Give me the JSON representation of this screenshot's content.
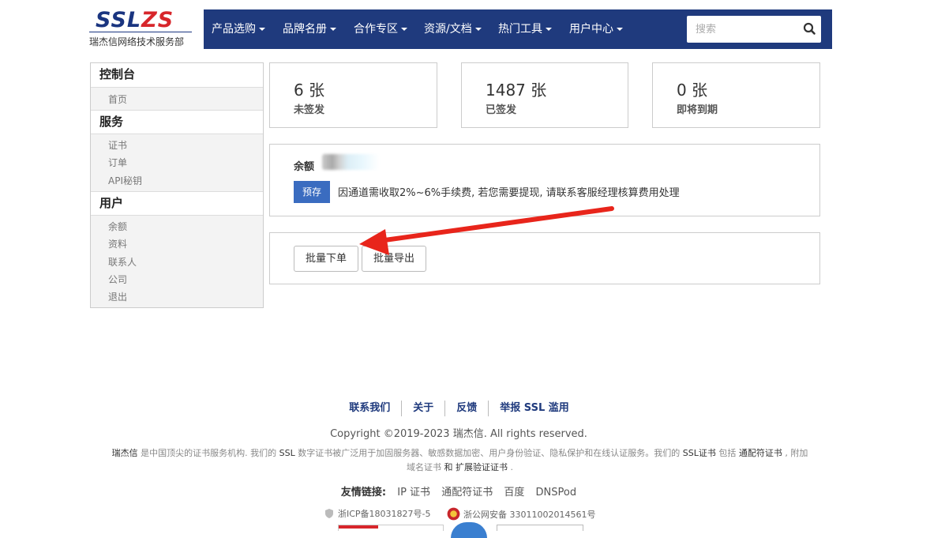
{
  "brand": {
    "logo_a": "SSL",
    "logo_b": "ZS",
    "subtitle": "瑞杰信网络技术服务部"
  },
  "nav": {
    "items": [
      "产品选购",
      "品牌名册",
      "合作专区",
      "资源/文档",
      "热门工具",
      "用户中心"
    ],
    "search_placeholder": "搜索"
  },
  "sidebar": {
    "sections": [
      {
        "title": "控制台",
        "links": [
          "首页"
        ]
      },
      {
        "title": "服务",
        "links": [
          "证书",
          "订单",
          "API秘钥"
        ]
      },
      {
        "title": "用户",
        "links": [
          "余额",
          "资料",
          "联系人",
          "公司",
          "退出"
        ]
      }
    ]
  },
  "stats": [
    {
      "value": "6 张",
      "label": "未签发"
    },
    {
      "value": "1487 张",
      "label": "已签发"
    },
    {
      "value": "0 张",
      "label": "即将到期"
    }
  ],
  "balance": {
    "label": "余额",
    "badge": "预存",
    "notice": "因通道需收取2%~6%手续费, 若您需要提现, 请联系客服经理核算费用处理"
  },
  "actions": {
    "bulk_order": "批量下单",
    "bulk_export": "批量导出"
  },
  "footer": {
    "links": [
      "联系我们",
      "关于",
      "反馈",
      "举报 SSL 滥用"
    ],
    "copyright": "Copyright ©2019-2023 瑞杰信. All rights reserved.",
    "desc": {
      "p1": "瑞杰信",
      "p2": " 是中国顶尖的证书服务机构. 我们的 ",
      "p3": "SSL",
      "p4": " 数字证书被广泛用于加固服务器、敏感数据加密、用户身份验证、隐私保护和在线认证服务。我们的 ",
      "p5": "SSL证书",
      "p6": " 包括 ",
      "p7": "通配符证书",
      "p8": " , 附加域名证书 ",
      "p9": "和",
      "p10": " 扩展验证证书",
      "p11": " ."
    },
    "friends_title": "友情链接:",
    "friends": [
      "IP 证书",
      "通配符证书",
      "百度",
      "DNSPod"
    ],
    "icp": "浙ICP备18031827号-5",
    "police": "浙公网安备 33011002014561号"
  },
  "colors": {
    "nav_bg": "#1f3a7d",
    "accent_red": "#d7262b",
    "badge_blue": "#3a6cc0"
  }
}
